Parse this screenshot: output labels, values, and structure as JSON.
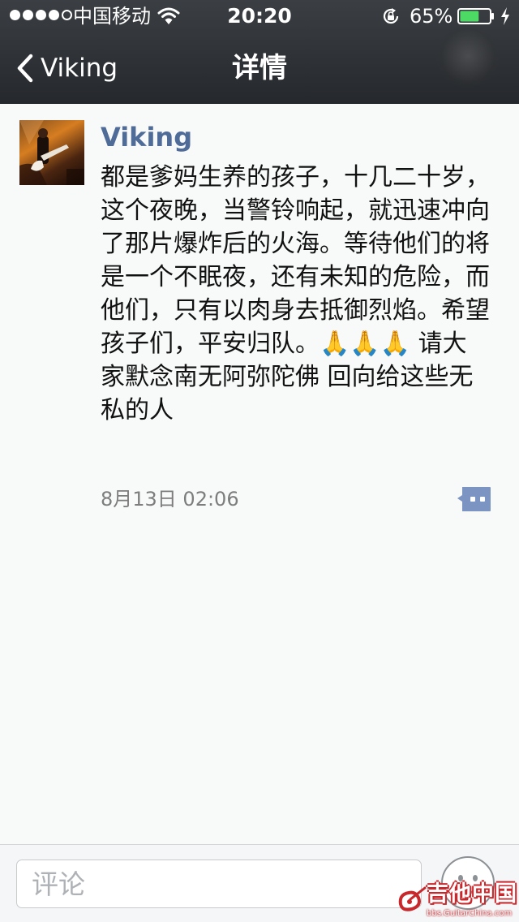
{
  "status_bar": {
    "carrier": "中国移动",
    "time": "20:20",
    "battery_percent": "65%",
    "signal_bars_filled": 4,
    "signal_bars_total": 5,
    "battery_level": 0.65,
    "icons": [
      "signal-dots",
      "wifi-icon",
      "rotation-lock-icon",
      "battery-icon",
      "charging-bolt-icon"
    ]
  },
  "nav": {
    "back_label": "Viking",
    "title": "详情",
    "back_icon": "chevron-left-icon"
  },
  "post": {
    "author": "Viking",
    "text": "都是爹妈生养的孩子，十几二十岁，这个夜晚，当警铃响起，就迅速冲向了那片爆炸后的火海。等待他们的将是一个不眠夜，还有未知的危险，而他们，只有以肉身去抵御烈焰。希望孩子们，平安归队。🙏🙏🙏 请大家默念南无阿弥陀佛 回向给这些无私的人",
    "timestamp": "8月13日 02:06",
    "comment_icon": "comment-bubble-icon"
  },
  "comment_bar": {
    "placeholder": "评论",
    "emoji_icon": "emoji-smile-icon"
  },
  "watermark": {
    "text": "吉他中国",
    "url": "bbs.GuitarChina.com"
  },
  "colors": {
    "nav_bg": "#2d3034",
    "author_name": "#4f6b98",
    "battery_green": "#4cd964",
    "comment_icon": "#7b94c2"
  }
}
